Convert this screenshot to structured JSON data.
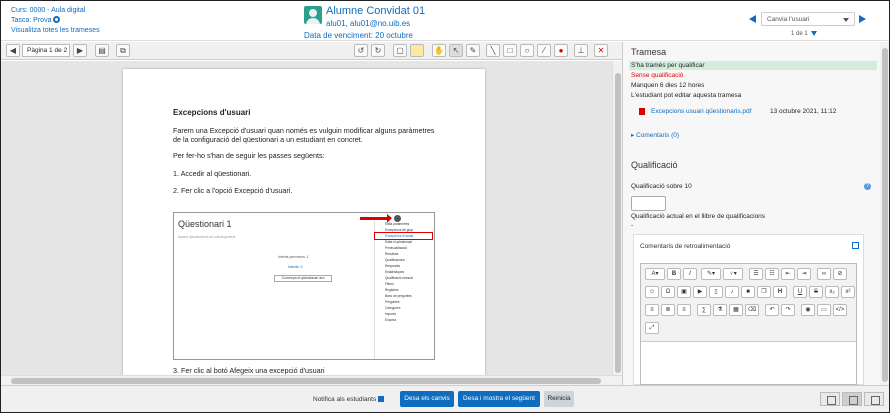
{
  "header": {
    "course": "Curs: 0000 - Aula digital",
    "task": "Tasca: Prova",
    "view_all": "Visualitza totes les trameses",
    "student_name": "Alumne Convidat 01",
    "student_email": "alu01, alu01@no.uib.es",
    "due_date": "Data de venciment: 20 octubre",
    "user_select": "Canvia l'usuari",
    "count": "1 de 1"
  },
  "toolbar": {
    "page_select": "Pàgina 1 de 2"
  },
  "document": {
    "heading": "Excepcions d'usuari",
    "p1": "Farem una Excepció d'usuari quan només es vulguin modificar alguns paràmetres de la configuració del qüestionari a un estudiant en concret.",
    "p2": "Per fer-ho s'han de seguir les passes següents:",
    "step1": "1. Accedir al qüestionari.",
    "step2": "2. Fer clic a l'opció Excepció d'usuari.",
    "step3": "3. Fer clic al botó Afegeix una excepció d'usuari",
    "shot": {
      "title": "Qüestionari 1",
      "subtitle": "Aquest qüestionari és de cultura general",
      "attempts": "Intents permesos: 1",
      "link": "Intents: 0",
      "button": "Comença el qüestionari ara",
      "menu": [
        "Edita paràmetres",
        "Excepcions de grup",
        "Excepcions d'usuari",
        "Edita el qüestionari",
        "Previsualització",
        "Resultats",
        "Qualificacions",
        "Respostes",
        "Estadístiques",
        "Qualificació manual",
        "Filtres",
        "Registres",
        "Banc de preguntes",
        "Preguntes",
        "Categories",
        "Importa",
        "Exporta"
      ]
    }
  },
  "panel": {
    "submission_title": "Tramesa",
    "status": "S'ha tramès per qualificar",
    "grading_status": "Sense qualificació",
    "time_left": "Manquen 6 dies 12 hores",
    "can_edit": "L'estudiant pot editar aquesta tramesa",
    "file_name": "Excepcions usuari qüestionaris.pdf",
    "file_date": "13 octubre 2021, 11:12",
    "comments": "Comentaris (0)",
    "grade_title": "Qualificació",
    "grade_label": "Qualificació sobre 10",
    "current_grade": "Qualificació actual en el llibre de qualificacions",
    "current_grade_value": "-",
    "feedback_title": "Comentaris de retroalimentació"
  },
  "bottom": {
    "notify": "Notifica als estudiants",
    "save": "Desa els canvis",
    "save_next": "Desa i mostra el següent",
    "reset": "Reinicia"
  },
  "colors": {
    "accent": "#0f6cbf",
    "status_green": "#d4edda",
    "error_red": "#dd0000"
  }
}
